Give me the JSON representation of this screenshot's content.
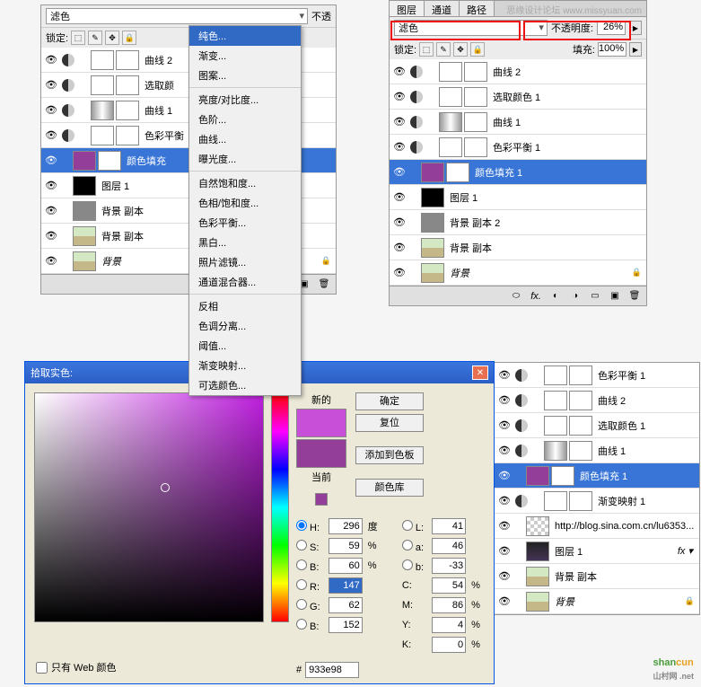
{
  "leftPanel": {
    "blendMode": "滤色",
    "opacityLabel": "不透",
    "lockLabel": "锁定:",
    "layers": [
      {
        "name": "曲线 2",
        "thumb": "white",
        "adj": true,
        "mask": true
      },
      {
        "name": "选取颜",
        "thumb": "white",
        "adj": true,
        "mask": true
      },
      {
        "name": "曲线 1",
        "thumb": "grad",
        "adj": true,
        "mask": true
      },
      {
        "name": "色彩平衡",
        "thumb": "white",
        "adj": true,
        "mask": true
      },
      {
        "name": "颜色填充",
        "thumb": "purple",
        "adj": false,
        "mask": true,
        "selected": true
      },
      {
        "name": "图层 1",
        "thumb": "black"
      },
      {
        "name": "背景 副本",
        "thumb": "gray"
      },
      {
        "name": "背景 副本",
        "thumb": "img"
      },
      {
        "name": "背景",
        "thumb": "img",
        "italic": true,
        "locked": true
      }
    ]
  },
  "rightPanel": {
    "tabs": [
      "图层",
      "通道",
      "路径"
    ],
    "watermark": "思缘设计论坛  www.missyuan.com",
    "blendMode": "滤色",
    "opacityLabel": "不透明度:",
    "opacityValue": "26%",
    "lockLabel": "锁定:",
    "fillLabel": "填充:",
    "fillValue": "100%",
    "layers": [
      {
        "name": "曲线 2",
        "thumb": "white",
        "adj": true,
        "mask": true
      },
      {
        "name": "选取颜色 1",
        "thumb": "white",
        "adj": true,
        "mask": true
      },
      {
        "name": "曲线 1",
        "thumb": "grad",
        "adj": true,
        "mask": true
      },
      {
        "name": "色彩平衡 1",
        "thumb": "white",
        "adj": true,
        "mask": true
      },
      {
        "name": "颜色填充 1",
        "thumb": "purple",
        "mask": true,
        "selected": true
      },
      {
        "name": "图层 1",
        "thumb": "black"
      },
      {
        "name": "背景 副本 2",
        "thumb": "gray"
      },
      {
        "name": "背景 副本",
        "thumb": "img"
      },
      {
        "name": "背景",
        "thumb": "img",
        "italic": true,
        "locked": true
      }
    ]
  },
  "bottomRightPanel": {
    "layers": [
      {
        "name": "色彩平衡 1",
        "thumb": "white",
        "adj": true,
        "mask": true
      },
      {
        "name": "曲线 2",
        "thumb": "white",
        "adj": true,
        "mask": true
      },
      {
        "name": "选取颜色 1",
        "thumb": "white",
        "adj": true,
        "mask": true
      },
      {
        "name": "曲线 1",
        "thumb": "grad",
        "adj": true,
        "mask": true
      },
      {
        "name": "颜色填充 1",
        "thumb": "purple",
        "mask": true,
        "selected": true
      },
      {
        "name": "渐变映射 1",
        "thumb": "white",
        "adj": true,
        "mask": true
      },
      {
        "name": "http://blog.sina.com.cn/lu6353...",
        "thumb": "checker"
      },
      {
        "name": "图层 1",
        "thumb": "dark",
        "fx": true
      },
      {
        "name": "背景 副本",
        "thumb": "img"
      },
      {
        "name": "背景",
        "thumb": "img",
        "italic": true,
        "locked": true
      }
    ]
  },
  "dropdown": {
    "items": [
      {
        "label": "纯色...",
        "hl": true
      },
      {
        "label": "渐变..."
      },
      {
        "label": "图案..."
      },
      {
        "sep": true
      },
      {
        "label": "亮度/对比度..."
      },
      {
        "label": "色阶..."
      },
      {
        "label": "曲线..."
      },
      {
        "label": "曝光度..."
      },
      {
        "sep": true
      },
      {
        "label": "自然饱和度..."
      },
      {
        "label": "色相/饱和度..."
      },
      {
        "label": "色彩平衡..."
      },
      {
        "label": "黑白..."
      },
      {
        "label": "照片滤镜..."
      },
      {
        "label": "通道混合器..."
      },
      {
        "sep": true
      },
      {
        "label": "反相"
      },
      {
        "label": "色调分离..."
      },
      {
        "label": "阈值..."
      },
      {
        "label": "渐变映射..."
      },
      {
        "label": "可选颜色..."
      }
    ]
  },
  "colorPicker": {
    "title": "拾取实色:",
    "newLabel": "新的",
    "curLabel": "当前",
    "btnOk": "确定",
    "btnReset": "复位",
    "btnAdd": "添加到色板",
    "btnLib": "颜色库",
    "H": "296",
    "Hu": "度",
    "S": "59",
    "Su": "%",
    "Bv": "60",
    "Bu": "%",
    "R": "147",
    "G": "62",
    "Bb": "152",
    "L": "41",
    "a": "46",
    "b": "-33",
    "C": "54",
    "Cu": "%",
    "M": "86",
    "Mu": "%",
    "Y": "4",
    "Yu": "%",
    "K": "0",
    "Ku": "%",
    "hex": "933e98",
    "webOnly": "只有 Web 颜色"
  },
  "logo": {
    "p1": "shan",
    "p2": "cun",
    "sub": "山村网 .net"
  }
}
